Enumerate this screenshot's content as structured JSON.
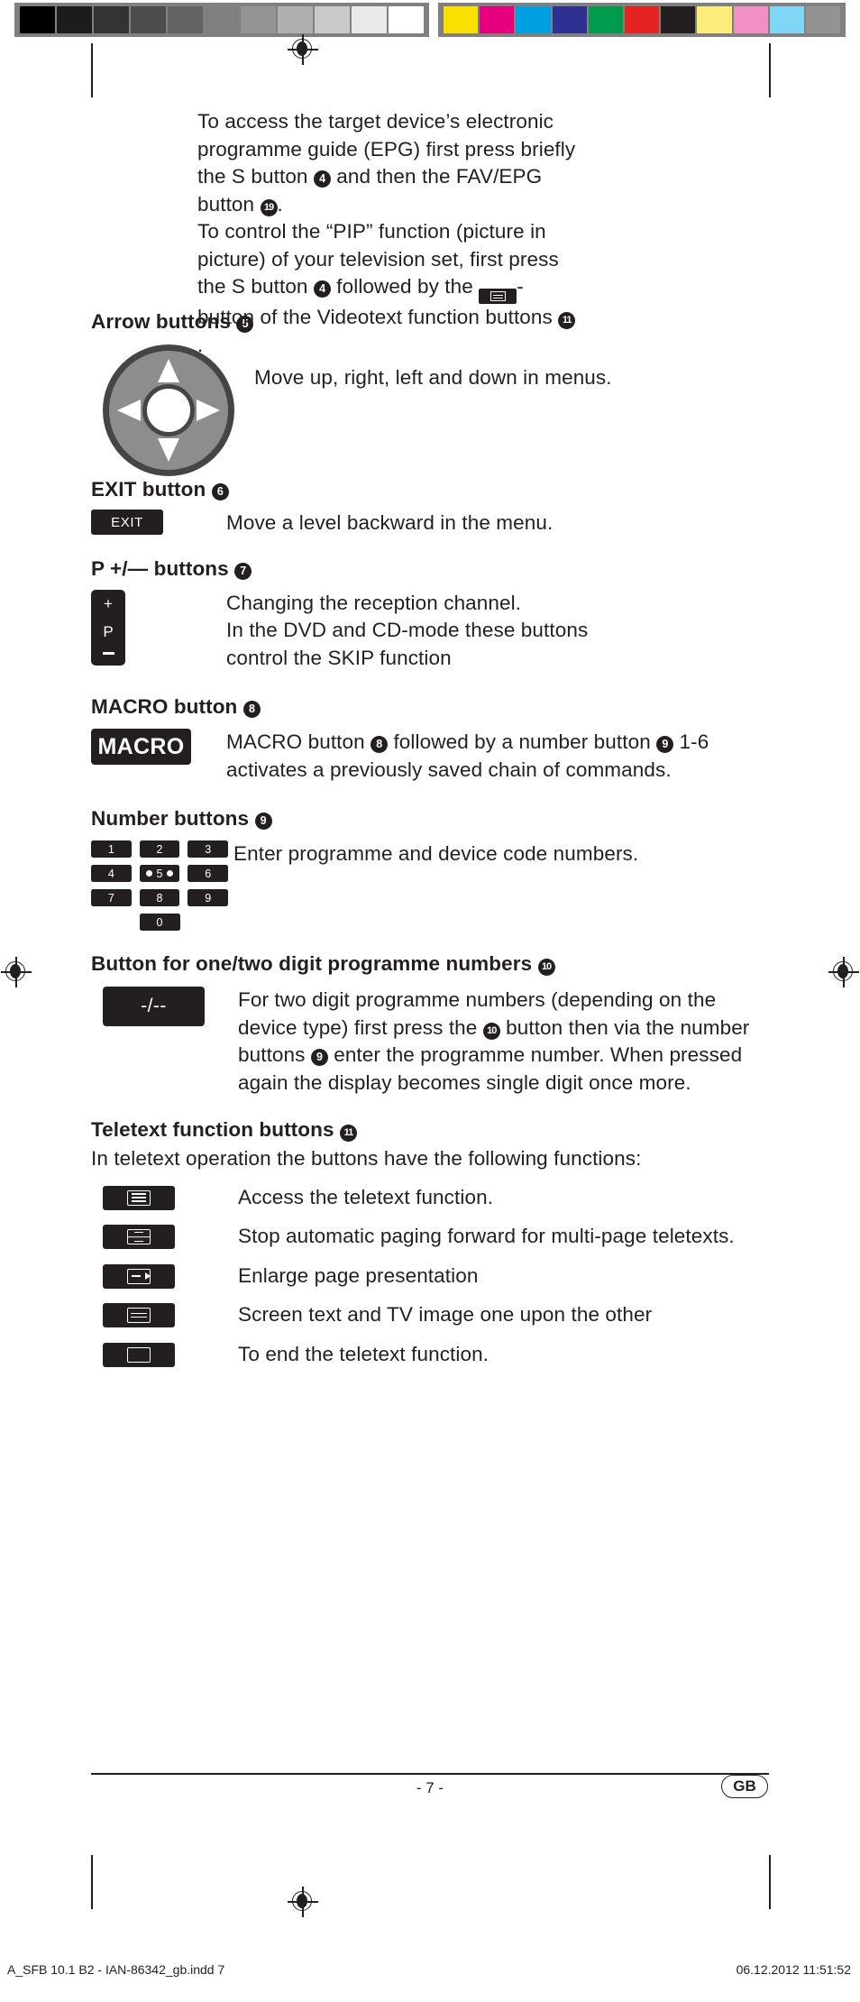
{
  "calibration": {
    "gray_swatches": [
      "#000000",
      "#1c1c1c",
      "#333333",
      "#4d4d4d",
      "#636363",
      "#808080",
      "#949494",
      "#b0b0b0",
      "#c9c9c9",
      "#e9e9e9",
      "#ffffff"
    ],
    "color_swatches": [
      "#f8e000",
      "#e6007e",
      "#00a0e3",
      "#2e3192",
      "#009b4b",
      "#e52421",
      "#231f20",
      "#fbee7a",
      "#f290c4",
      "#7fd6f5",
      "#939393"
    ],
    "bar_background": "#808080"
  },
  "intro": {
    "paragraph_1_part_a": "To access the target device’s electronic programme guide (EPG) first press briefly the S button ",
    "badge_s_button": "4",
    "paragraph_1_part_b": " and then the FAV/EPG button ",
    "badge_fav_epg": "19",
    "paragraph_1_part_c": ".",
    "paragraph_2_part_a": "To control the “PIP” function (picture in picture) of your television set, first press the S button ",
    "badge_s_button_2": "4",
    "paragraph_2_part_b": " followed by the ",
    "paragraph_2_part_c": "- button of the Videotext function buttons ",
    "badge_videotext": "11",
    "paragraph_2_part_d": "."
  },
  "sections": {
    "arrow_buttons": {
      "heading": "Arrow buttons ",
      "badge": "5",
      "description": "Move up, right, left and down in menus."
    },
    "exit_button": {
      "heading": "EXIT button ",
      "badge": "6",
      "key_label": "EXIT",
      "description": "Move a level backward in the menu."
    },
    "p_buttons": {
      "heading": "P +/— buttons ",
      "badge": "7",
      "key_plus": "+",
      "key_p": "P",
      "description_line_1": "Changing the reception channel.",
      "description_line_2": "In the DVD and CD-mode these buttons",
      "description_line_3": "control the SKIP function"
    },
    "macro_button": {
      "heading": "MACRO button ",
      "badge": "8",
      "key_label": "MACRO",
      "desc_part_a": "MACRO button ",
      "desc_badge_1": "8",
      "desc_part_b": " followed by a number button ",
      "desc_badge_2": "9",
      "desc_part_c": " 1-6 activates a previously saved chain of commands."
    },
    "number_buttons": {
      "heading": "Number buttons ",
      "badge": "9",
      "keys": [
        [
          "1",
          "2",
          "3"
        ],
        [
          "4",
          "5",
          "6"
        ],
        [
          "7",
          "8",
          "9"
        ]
      ],
      "zero_key": "0",
      "description": "Enter programme and device code numbers."
    },
    "digit_button": {
      "heading": "Button for one/two digit programme numbers ",
      "badge": "10",
      "key_label": "-/--",
      "desc_part_a": "For two digit programme numbers (depending on the device type) first press the ",
      "desc_badge_1": "10",
      "desc_part_b": " button then via the number buttons ",
      "desc_badge_2": "9",
      "desc_part_c": " enter the programme number. When pressed again the display becomes single digit once more."
    },
    "teletext": {
      "heading": "Teletext function buttons ",
      "badge": "11",
      "intro": "In teletext operation the buttons have the following functions:",
      "rows": [
        {
          "icon": "teletext-access-icon",
          "text": "Access the teletext function."
        },
        {
          "icon": "teletext-hold-icon",
          "text": "Stop automatic paging forward for multi-page teletexts."
        },
        {
          "icon": "teletext-enlarge-icon",
          "text": "Enlarge page presentation"
        },
        {
          "icon": "teletext-mix-icon",
          "text": "Screen text and TV image one upon the other"
        },
        {
          "icon": "teletext-cancel-icon",
          "text": "To end the teletext function."
        }
      ]
    }
  },
  "footer": {
    "page_number": "- 7 -",
    "language_badge": "GB"
  },
  "imprint": {
    "left": "A_SFB 10.1 B2 - IAN-86342_gb.indd   7",
    "right": "06.12.2012   11:51:52"
  }
}
